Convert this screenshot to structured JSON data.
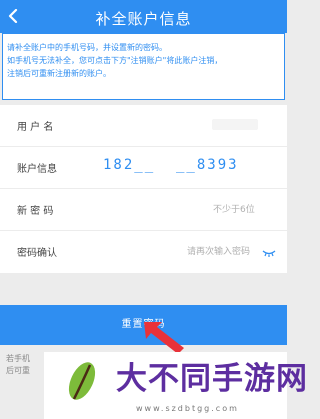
{
  "header": {
    "title": "补全账户信息"
  },
  "notice": {
    "lines": [
      "请补全账户中的手机号码，并设置新的密码。",
      "如手机号无法补全，您可点击下方\"注销账户\"将此账户注销，",
      "注销后可重新注册新的账户。"
    ]
  },
  "form": {
    "username_label": "用 户 名",
    "account_label": "账户信息",
    "account_value": "182__  __8393",
    "new_password_label": "新 密 码",
    "new_password_placeholder": "不少于6位",
    "confirm_label": "密码确认",
    "confirm_placeholder": "请再次输入密码"
  },
  "button": {
    "label": "重置密码"
  },
  "tip": {
    "lines": [
      "若手机",
      "后可重"
    ]
  },
  "watermark": {
    "text": "大不同手游网",
    "url": "www.szdbtgg.com"
  },
  "colors": {
    "primary": "#2f8ef1",
    "background": "#ececec",
    "watermark": "#5d2ea0",
    "arrow": "#e8323a"
  }
}
